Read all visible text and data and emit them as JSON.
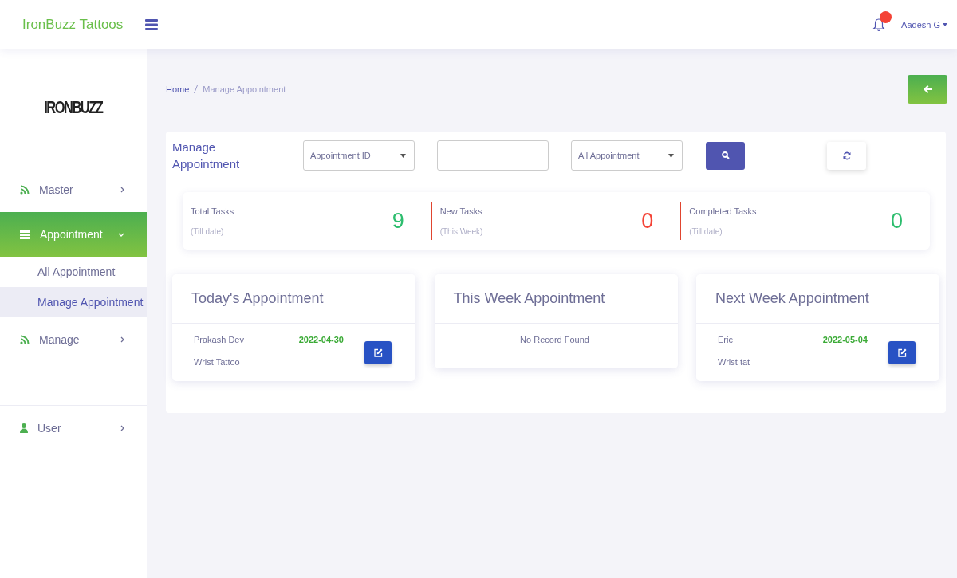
{
  "header": {
    "brand": "IronBuzz Tattoos",
    "user": "Aadesh G",
    "notification_badge": true
  },
  "sidebar": {
    "logo": "IRONBUZZ",
    "items": [
      {
        "label": "Master",
        "selected": false,
        "expanded": false
      },
      {
        "label": "Appointment",
        "selected": true,
        "expanded": true,
        "children": [
          {
            "label": "All Appointment",
            "selected": false
          },
          {
            "label": "Manage Appointment",
            "selected": true
          }
        ]
      },
      {
        "label": "Manage",
        "selected": false,
        "expanded": false
      },
      {
        "label": "User",
        "selected": false,
        "expanded": false
      }
    ]
  },
  "breadcrumb": [
    "Home",
    "Manage Appointment"
  ],
  "filter": {
    "title": "Manage Appointment",
    "id_select": "Appointment ID",
    "type_select": "All Appointment"
  },
  "stats": [
    {
      "label": "Total Tasks",
      "sub": "(Till date)",
      "value": "9",
      "color": "#2dbd6e"
    },
    {
      "label": "New Tasks",
      "sub": "(This Week)",
      "value": "0",
      "color": "#f44336"
    },
    {
      "label": "Completed Tasks",
      "sub": "(Till date)",
      "value": "0",
      "color": "#2dbd6e"
    }
  ],
  "panels": [
    {
      "title": "Today's Appointment",
      "rows": [
        {
          "name": "Prakash Dev",
          "date": "2022-04-30",
          "service": "Wrist Tattoo"
        }
      ]
    },
    {
      "title": "This Week Appointment",
      "empty_text": "No Record Found"
    },
    {
      "title": "Next Week Appointment",
      "rows": [
        {
          "name": "Eric",
          "date": "2022-05-04",
          "service": "Wrist tat"
        }
      ]
    }
  ]
}
